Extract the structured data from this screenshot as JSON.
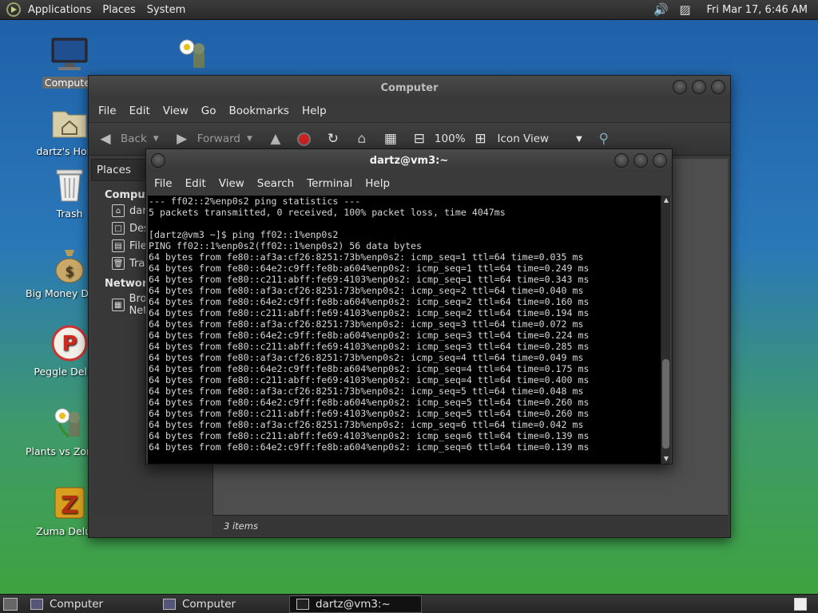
{
  "top_panel": {
    "menus": [
      "Applications",
      "Places",
      "System"
    ],
    "clock": "Fri Mar 17,  6:46 AM",
    "icons": [
      "distro-logo-icon",
      "volume-icon",
      "network-icon"
    ]
  },
  "desktop_icons": [
    {
      "label": "Computer",
      "icon": "computer-icon"
    },
    {
      "label": "dartz's Home",
      "icon": "home-folder-icon"
    },
    {
      "label": "Trash",
      "icon": "trash-icon"
    },
    {
      "label": "Big Money Deluxe",
      "icon": "money-bag-icon"
    },
    {
      "label": "Peggle Deluxe",
      "icon": "peggle-icon"
    },
    {
      "label": "Plants vs Zombies",
      "icon": "plants-icon"
    },
    {
      "label": "Zuma Deluxe",
      "icon": "zuma-icon"
    }
  ],
  "nautilus": {
    "title": "Computer",
    "menus": [
      "File",
      "Edit",
      "View",
      "Go",
      "Bookmarks",
      "Help"
    ],
    "toolbar": {
      "back": "Back",
      "forward": "Forward",
      "zoom": "100%",
      "view_mode": "Icon View"
    },
    "sidebar_header": "Places",
    "sidebar": {
      "group_computer": "Computer",
      "items": [
        "dartz",
        "Desktop",
        "File System",
        "Trash"
      ],
      "group_network": "Network",
      "network_items": [
        "Browse Network"
      ]
    },
    "status": "3 items"
  },
  "terminal": {
    "title": "dartz@vm3:~",
    "menus": [
      "File",
      "Edit",
      "View",
      "Search",
      "Terminal",
      "Help"
    ],
    "lines": [
      "--- ff02::2%enp0s2 ping statistics ---",
      "5 packets transmitted, 0 received, 100% packet loss, time 4047ms",
      "",
      "[dartz@vm3 ~]$ ping ff02::1%enp0s2",
      "PING ff02::1%enp0s2(ff02::1%enp0s2) 56 data bytes",
      "64 bytes from fe80::af3a:cf26:8251:73b%enp0s2: icmp_seq=1 ttl=64 time=0.035 ms",
      "64 bytes from fe80::64e2:c9ff:fe8b:a604%enp0s2: icmp_seq=1 ttl=64 time=0.249 ms",
      "64 bytes from fe80::c211:abff:fe69:4103%enp0s2: icmp_seq=1 ttl=64 time=0.343 ms",
      "64 bytes from fe80::af3a:cf26:8251:73b%enp0s2: icmp_seq=2 ttl=64 time=0.040 ms",
      "64 bytes from fe80::64e2:c9ff:fe8b:a604%enp0s2: icmp_seq=2 ttl=64 time=0.160 ms",
      "64 bytes from fe80::c211:abff:fe69:4103%enp0s2: icmp_seq=2 ttl=64 time=0.194 ms",
      "64 bytes from fe80::af3a:cf26:8251:73b%enp0s2: icmp_seq=3 ttl=64 time=0.072 ms",
      "64 bytes from fe80::64e2:c9ff:fe8b:a604%enp0s2: icmp_seq=3 ttl=64 time=0.224 ms",
      "64 bytes from fe80::c211:abff:fe69:4103%enp0s2: icmp_seq=3 ttl=64 time=0.285 ms",
      "64 bytes from fe80::af3a:cf26:8251:73b%enp0s2: icmp_seq=4 ttl=64 time=0.049 ms",
      "64 bytes from fe80::64e2:c9ff:fe8b:a604%enp0s2: icmp_seq=4 ttl=64 time=0.175 ms",
      "64 bytes from fe80::c211:abff:fe69:4103%enp0s2: icmp_seq=4 ttl=64 time=0.400 ms",
      "64 bytes from fe80::af3a:cf26:8251:73b%enp0s2: icmp_seq=5 ttl=64 time=0.048 ms",
      "64 bytes from fe80::64e2:c9ff:fe8b:a604%enp0s2: icmp_seq=5 ttl=64 time=0.260 ms",
      "64 bytes from fe80::c211:abff:fe69:4103%enp0s2: icmp_seq=5 ttl=64 time=0.260 ms",
      "64 bytes from fe80::af3a:cf26:8251:73b%enp0s2: icmp_seq=6 ttl=64 time=0.042 ms",
      "64 bytes from fe80::c211:abff:fe69:4103%enp0s2: icmp_seq=6 ttl=64 time=0.139 ms",
      "64 bytes from fe80::64e2:c9ff:fe8b:a604%enp0s2: icmp_seq=6 ttl=64 time=0.139 ms"
    ]
  },
  "taskbar": {
    "tasks": [
      "Computer",
      "Computer",
      "dartz@vm3:~"
    ],
    "active_index": 2
  },
  "colors": {
    "panel": "#2f2f2f",
    "terminal_bg": "#000000",
    "terminal_fg": "#d6d6d6"
  }
}
